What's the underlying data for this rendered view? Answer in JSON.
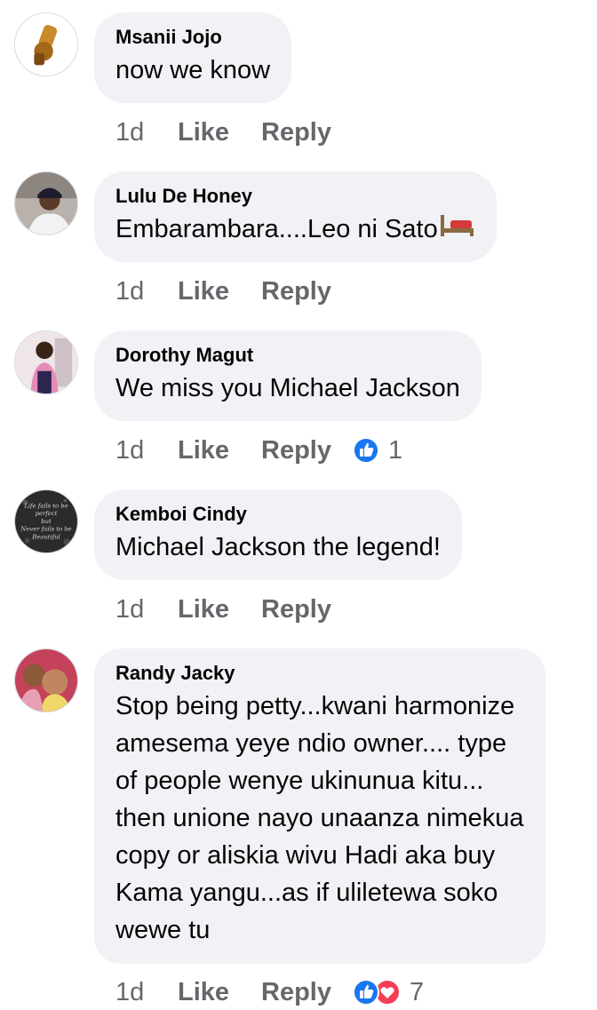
{
  "comments": [
    {
      "author": "Msanii Jojo",
      "text": "now we know",
      "time": "1d",
      "like": "Like",
      "reply": "Reply"
    },
    {
      "author": "Lulu De Honey",
      "text": "Embarambara....Leo ni Sato",
      "time": "1d",
      "like": "Like",
      "reply": "Reply"
    },
    {
      "author": "Dorothy Magut",
      "text": "We miss you Michael Jackson",
      "time": "1d",
      "like": "Like",
      "reply": "Reply",
      "reaction_count": "1"
    },
    {
      "author": "Kemboi Cindy",
      "text": "Michael Jackson the legend!",
      "time": "1d",
      "like": "Like",
      "reply": "Reply",
      "avatar_text": [
        "Life fails to be",
        "perfect",
        "but",
        "Never fails to be",
        "Beautiful"
      ]
    },
    {
      "author": "Randy Jacky",
      "lines": [
        "Stop being petty...kwani harmonize",
        "amesema yeye ndio owner.... type",
        "of people wenye ukinunua kitu...",
        "then unione nayo unaanza nimekua",
        "copy or aliskia wivu Hadi aka buy",
        "Kama yangu...as if uliletewa soko",
        "wewe tu"
      ],
      "time": "1d",
      "like": "Like",
      "reply": "Reply",
      "reaction_count": "7"
    }
  ],
  "colors": {
    "bubble": "#f0f2f5",
    "like_blue": "#1877f2",
    "love_red": "#f33e58",
    "meta_gray": "#65676b"
  },
  "icons": {
    "like_reaction": "thumbs-up-icon",
    "love_reaction": "heart-icon",
    "bed_emoji": "bed-emoji"
  }
}
